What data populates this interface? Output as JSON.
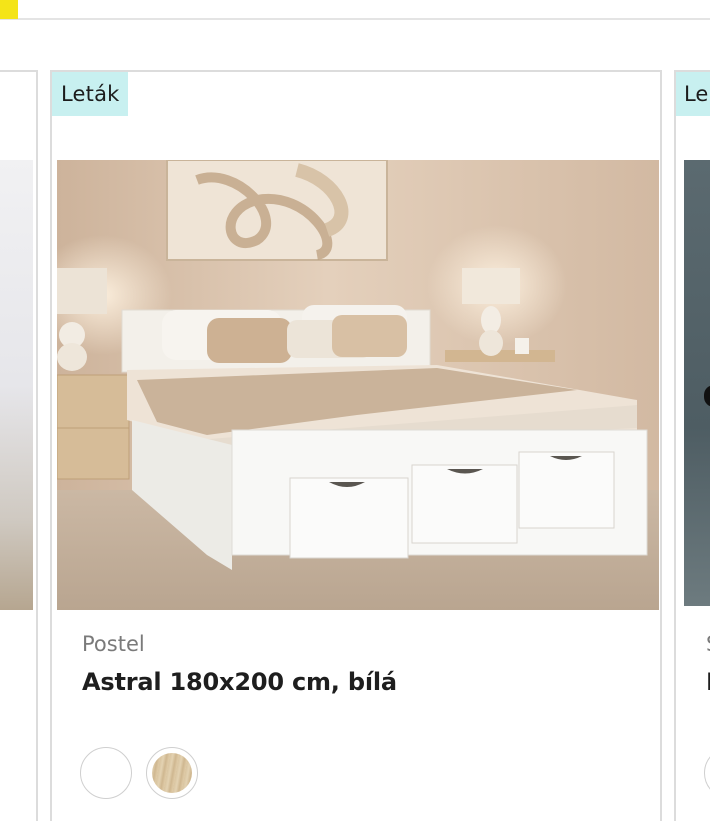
{
  "header": {
    "accent_color": "#f4e418"
  },
  "cards": {
    "left": {
      "image_alt": "bedroom-photo"
    },
    "main": {
      "badge": "Leták",
      "badge_color": "#c8f0f0",
      "category": "Postel",
      "title": "Astral 180x200 cm, bílá",
      "image": "bed-with-drawers-photo",
      "swatches": [
        {
          "name": "white",
          "color": "#ffffff"
        },
        {
          "name": "oak",
          "color": "#d9c4a0"
        }
      ]
    },
    "right": {
      "badge": "Le",
      "category": "S",
      "title": "I"
    }
  }
}
